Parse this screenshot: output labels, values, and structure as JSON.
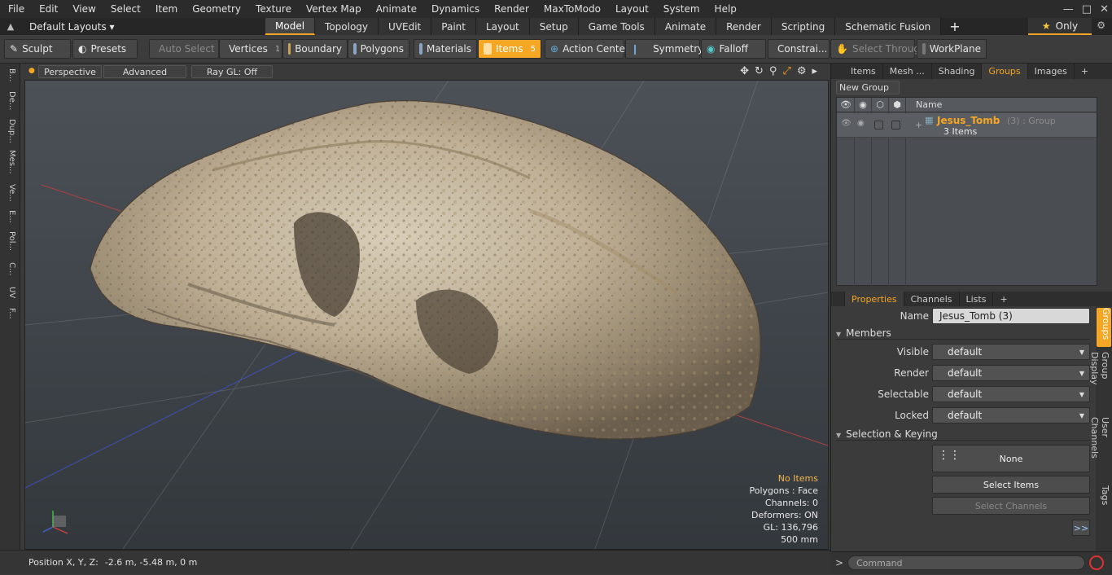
{
  "menu": [
    "File",
    "Edit",
    "View",
    "Select",
    "Item",
    "Geometry",
    "Texture",
    "Vertex Map",
    "Animate",
    "Dynamics",
    "Render",
    "MaxToModo",
    "Layout",
    "System",
    "Help"
  ],
  "layout_selector": "Default Layouts ▾",
  "mode_tabs": [
    {
      "label": "Model",
      "active": true
    },
    {
      "label": "Topology",
      "active": false
    },
    {
      "label": "UVEdit",
      "active": false
    },
    {
      "label": "Paint",
      "active": false
    },
    {
      "label": "Layout",
      "active": false
    },
    {
      "label": "Setup",
      "active": false
    },
    {
      "label": "Game Tools",
      "active": false
    },
    {
      "label": "Animate",
      "active": false
    },
    {
      "label": "Render",
      "active": false
    },
    {
      "label": "Scripting",
      "active": false
    },
    {
      "label": "Schematic Fusion",
      "active": false
    }
  ],
  "only_button": "Only",
  "toolbar": {
    "sculpt": "Sculpt",
    "presets": "Presets",
    "auto_select": "Auto Select",
    "vertices": "Vertices",
    "vertices_count": "1",
    "boundary": "Boundary",
    "polygons": "Polygons",
    "materials": "Materials",
    "items": "Items",
    "items_count": "5",
    "action_center": "Action Center",
    "symmetry": "Symmetry",
    "falloff": "Falloff",
    "constraints": "Constrai...",
    "select_through": "Select Through",
    "workplane": "WorkPlane"
  },
  "left_strip": [
    "B...",
    "De...",
    "Dup...",
    "Mes...",
    "Ve...",
    "E...",
    "Pol...",
    "C...",
    "UV",
    "F..."
  ],
  "viewport": {
    "perspective": "Perspective",
    "advanced": "Advanced",
    "raygl": "Ray GL: Off",
    "info": {
      "items": "No Items",
      "polygons": "Polygons : Face",
      "channels": "Channels: 0",
      "deformers": "Deformers: ON",
      "gl": "GL: 136,796",
      "scale": "500 mm"
    }
  },
  "status": {
    "label": "Position X, Y, Z:",
    "value": "-2.6 m, -5.48 m, 0 m"
  },
  "right_tabs": [
    {
      "label": "Items",
      "active": false
    },
    {
      "label": "Mesh ...",
      "active": false
    },
    {
      "label": "Shading",
      "active": false
    },
    {
      "label": "Groups",
      "active": true
    },
    {
      "label": "Images",
      "active": false
    }
  ],
  "groups": {
    "new_group": "New Group",
    "name_header": "Name",
    "row": {
      "name": "Jesus_Tomb",
      "count": "(3)",
      "type": ": Group",
      "items": "3 Items"
    }
  },
  "prop_tabs": [
    {
      "label": "Properties",
      "active": true
    },
    {
      "label": "Channels",
      "active": false
    },
    {
      "label": "Lists",
      "active": false
    }
  ],
  "properties": {
    "name_label": "Name",
    "name_value": "Jesus_Tomb (3)",
    "members": "Members",
    "visible_label": "Visible",
    "visible_value": "default",
    "render_label": "Render",
    "render_value": "default",
    "selectable_label": "Selectable",
    "selectable_value": "default",
    "locked_label": "Locked",
    "locked_value": "default",
    "selection_keying": "Selection & Keying",
    "none_label": "None",
    "select_items": "Select Items",
    "select_channels": "Select Channels",
    "more": ">>"
  },
  "vertical_tabs": [
    "Groups",
    "Group Display",
    "User Channels",
    "Tags"
  ],
  "command": {
    "prompt": ">",
    "placeholder": "Command"
  },
  "colors": {
    "accent": "#f5a623",
    "panel": "#3b3b3b",
    "viewport_top": "#4b5157"
  }
}
